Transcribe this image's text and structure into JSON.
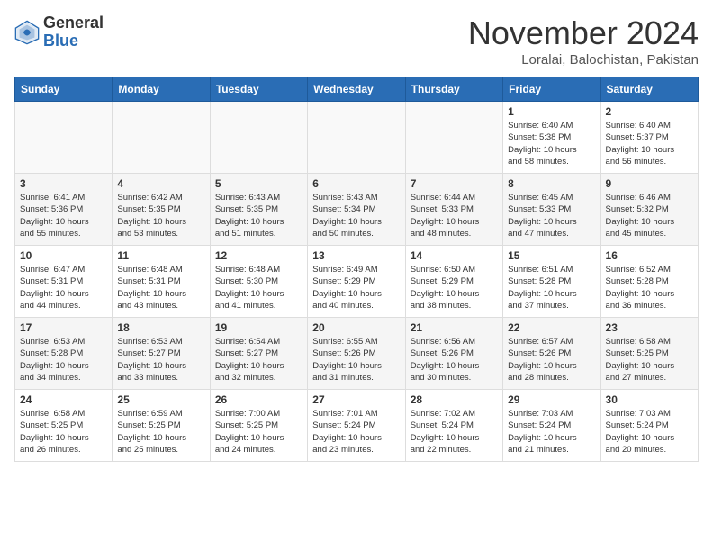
{
  "header": {
    "logo_line1": "General",
    "logo_line2": "Blue",
    "month_title": "November 2024",
    "location": "Loralai, Balochistan, Pakistan"
  },
  "weekdays": [
    "Sunday",
    "Monday",
    "Tuesday",
    "Wednesday",
    "Thursday",
    "Friday",
    "Saturday"
  ],
  "weeks": [
    [
      {
        "day": "",
        "info": ""
      },
      {
        "day": "",
        "info": ""
      },
      {
        "day": "",
        "info": ""
      },
      {
        "day": "",
        "info": ""
      },
      {
        "day": "",
        "info": ""
      },
      {
        "day": "1",
        "info": "Sunrise: 6:40 AM\nSunset: 5:38 PM\nDaylight: 10 hours\nand 58 minutes."
      },
      {
        "day": "2",
        "info": "Sunrise: 6:40 AM\nSunset: 5:37 PM\nDaylight: 10 hours\nand 56 minutes."
      }
    ],
    [
      {
        "day": "3",
        "info": "Sunrise: 6:41 AM\nSunset: 5:36 PM\nDaylight: 10 hours\nand 55 minutes."
      },
      {
        "day": "4",
        "info": "Sunrise: 6:42 AM\nSunset: 5:35 PM\nDaylight: 10 hours\nand 53 minutes."
      },
      {
        "day": "5",
        "info": "Sunrise: 6:43 AM\nSunset: 5:35 PM\nDaylight: 10 hours\nand 51 minutes."
      },
      {
        "day": "6",
        "info": "Sunrise: 6:43 AM\nSunset: 5:34 PM\nDaylight: 10 hours\nand 50 minutes."
      },
      {
        "day": "7",
        "info": "Sunrise: 6:44 AM\nSunset: 5:33 PM\nDaylight: 10 hours\nand 48 minutes."
      },
      {
        "day": "8",
        "info": "Sunrise: 6:45 AM\nSunset: 5:33 PM\nDaylight: 10 hours\nand 47 minutes."
      },
      {
        "day": "9",
        "info": "Sunrise: 6:46 AM\nSunset: 5:32 PM\nDaylight: 10 hours\nand 45 minutes."
      }
    ],
    [
      {
        "day": "10",
        "info": "Sunrise: 6:47 AM\nSunset: 5:31 PM\nDaylight: 10 hours\nand 44 minutes."
      },
      {
        "day": "11",
        "info": "Sunrise: 6:48 AM\nSunset: 5:31 PM\nDaylight: 10 hours\nand 43 minutes."
      },
      {
        "day": "12",
        "info": "Sunrise: 6:48 AM\nSunset: 5:30 PM\nDaylight: 10 hours\nand 41 minutes."
      },
      {
        "day": "13",
        "info": "Sunrise: 6:49 AM\nSunset: 5:29 PM\nDaylight: 10 hours\nand 40 minutes."
      },
      {
        "day": "14",
        "info": "Sunrise: 6:50 AM\nSunset: 5:29 PM\nDaylight: 10 hours\nand 38 minutes."
      },
      {
        "day": "15",
        "info": "Sunrise: 6:51 AM\nSunset: 5:28 PM\nDaylight: 10 hours\nand 37 minutes."
      },
      {
        "day": "16",
        "info": "Sunrise: 6:52 AM\nSunset: 5:28 PM\nDaylight: 10 hours\nand 36 minutes."
      }
    ],
    [
      {
        "day": "17",
        "info": "Sunrise: 6:53 AM\nSunset: 5:28 PM\nDaylight: 10 hours\nand 34 minutes."
      },
      {
        "day": "18",
        "info": "Sunrise: 6:53 AM\nSunset: 5:27 PM\nDaylight: 10 hours\nand 33 minutes."
      },
      {
        "day": "19",
        "info": "Sunrise: 6:54 AM\nSunset: 5:27 PM\nDaylight: 10 hours\nand 32 minutes."
      },
      {
        "day": "20",
        "info": "Sunrise: 6:55 AM\nSunset: 5:26 PM\nDaylight: 10 hours\nand 31 minutes."
      },
      {
        "day": "21",
        "info": "Sunrise: 6:56 AM\nSunset: 5:26 PM\nDaylight: 10 hours\nand 30 minutes."
      },
      {
        "day": "22",
        "info": "Sunrise: 6:57 AM\nSunset: 5:26 PM\nDaylight: 10 hours\nand 28 minutes."
      },
      {
        "day": "23",
        "info": "Sunrise: 6:58 AM\nSunset: 5:25 PM\nDaylight: 10 hours\nand 27 minutes."
      }
    ],
    [
      {
        "day": "24",
        "info": "Sunrise: 6:58 AM\nSunset: 5:25 PM\nDaylight: 10 hours\nand 26 minutes."
      },
      {
        "day": "25",
        "info": "Sunrise: 6:59 AM\nSunset: 5:25 PM\nDaylight: 10 hours\nand 25 minutes."
      },
      {
        "day": "26",
        "info": "Sunrise: 7:00 AM\nSunset: 5:25 PM\nDaylight: 10 hours\nand 24 minutes."
      },
      {
        "day": "27",
        "info": "Sunrise: 7:01 AM\nSunset: 5:24 PM\nDaylight: 10 hours\nand 23 minutes."
      },
      {
        "day": "28",
        "info": "Sunrise: 7:02 AM\nSunset: 5:24 PM\nDaylight: 10 hours\nand 22 minutes."
      },
      {
        "day": "29",
        "info": "Sunrise: 7:03 AM\nSunset: 5:24 PM\nDaylight: 10 hours\nand 21 minutes."
      },
      {
        "day": "30",
        "info": "Sunrise: 7:03 AM\nSunset: 5:24 PM\nDaylight: 10 hours\nand 20 minutes."
      }
    ]
  ]
}
